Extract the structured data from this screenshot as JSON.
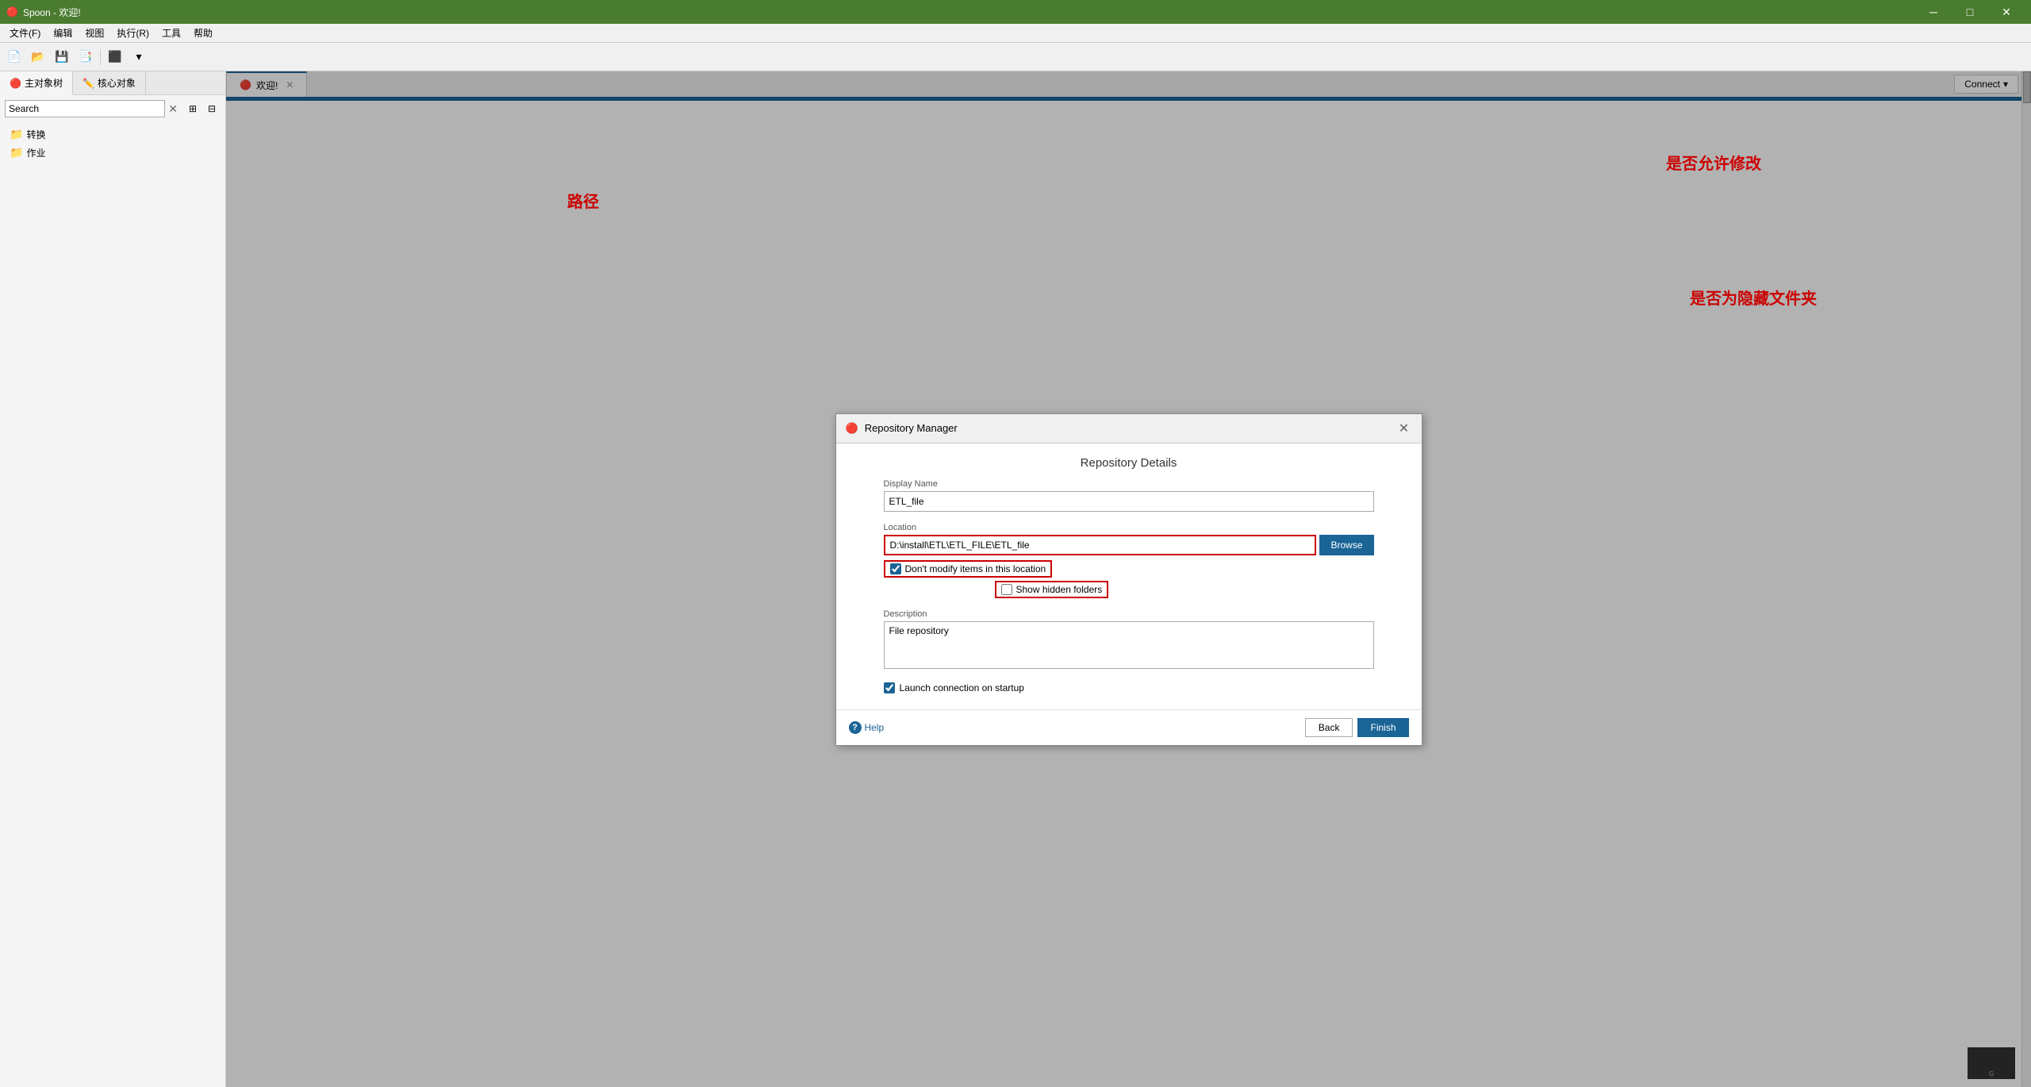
{
  "titlebar": {
    "title": "Spoon - 欢迎!",
    "icon": "🔴",
    "minimize": "─",
    "maximize": "□",
    "close": "✕"
  },
  "menubar": {
    "items": [
      "文件(F)",
      "编辑",
      "视图",
      "执行(R)",
      "工具",
      "帮助"
    ]
  },
  "toolbar": {
    "buttons": [
      "📄",
      "📁",
      "💾",
      "🖨️",
      "↩️",
      "⬆️"
    ]
  },
  "leftpanel": {
    "tabs": [
      {
        "label": "主对象树",
        "icon": "🔴",
        "active": true
      },
      {
        "label": "核心对象",
        "icon": "✏️",
        "active": false
      }
    ],
    "search_placeholder": "Search",
    "search_value": "Search",
    "tree_items": [
      {
        "label": "转换",
        "icon": "📁"
      },
      {
        "label": "作业",
        "icon": "📁"
      }
    ]
  },
  "contenttabs": {
    "tabs": [
      {
        "label": "欢迎!",
        "icon": "🔴",
        "active": true
      }
    ]
  },
  "header": {
    "connect_label": "Connect",
    "connect_dropdown": "▾"
  },
  "modal": {
    "title_bar": "Repository Manager",
    "title": "Repository Details",
    "close_btn": "✕",
    "icon": "🔴",
    "fields": {
      "display_name_label": "Display Name",
      "display_name_value": "ETL_file",
      "location_label": "Location",
      "location_value": "D:\\install\\ETL\\ETL_FILE\\ETL_file",
      "browse_btn": "Browse",
      "dont_modify_label": "Don't modify items in this location",
      "dont_modify_checked": true,
      "show_hidden_label": "Show hidden folders",
      "show_hidden_checked": false,
      "description_label": "Description",
      "description_value": "File repository",
      "startup_label": "Launch connection on startup",
      "startup_checked": true
    },
    "footer": {
      "help_label": "Help",
      "back_label": "Back",
      "finish_label": "Finish"
    }
  },
  "annotations": {
    "path_label": "路径",
    "modify_label": "是否允许修改",
    "hidden_label": "是否为隐藏文件夹"
  }
}
